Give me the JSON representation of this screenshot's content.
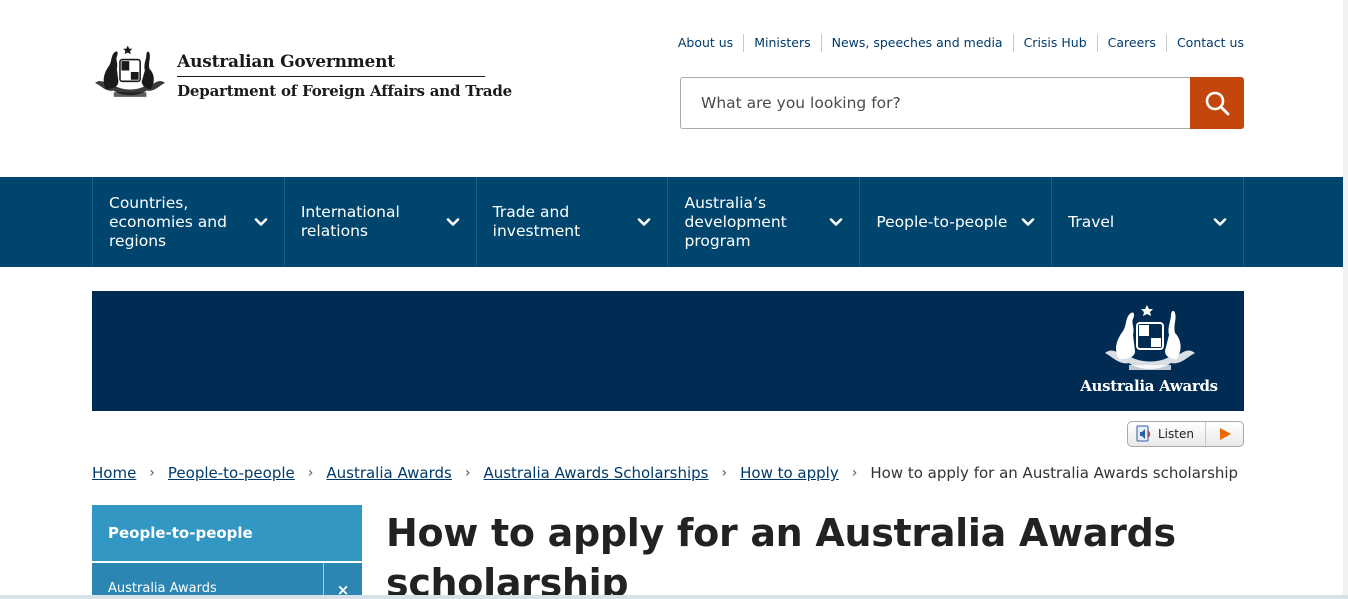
{
  "header": {
    "gov_name": "Australian Government",
    "dept_name": "Department of Foreign Affairs and Trade"
  },
  "utility_nav": [
    "About us",
    "Ministers",
    "News, speeches and media",
    "Crisis Hub",
    "Careers",
    "Contact us"
  ],
  "search": {
    "placeholder": "What are you looking for?",
    "button_icon": "search-icon"
  },
  "main_nav": [
    "Countries, economies and regions",
    "International relations",
    "Trade and investment",
    "Australia’s development program",
    "People-to-people",
    "Travel"
  ],
  "banner": {
    "logo_text": "Australia Awards"
  },
  "listen": {
    "label": "Listen"
  },
  "breadcrumb": {
    "links": [
      "Home",
      "People-to-people",
      "Australia Awards",
      "Australia Awards Scholarships",
      "How to apply"
    ],
    "current": "How to apply for an Australia Awards scholarship"
  },
  "sidebar": {
    "heading": "People-to-people",
    "item": "Australia Awards",
    "item_close": "×"
  },
  "page": {
    "title": "How to apply for an Australia Awards scholarship"
  },
  "colors": {
    "nav_bg": "#00456e",
    "banner_bg": "#002b53",
    "search_button": "#c3470c",
    "sidebar_head": "#3297c3",
    "link": "#003a6b"
  }
}
